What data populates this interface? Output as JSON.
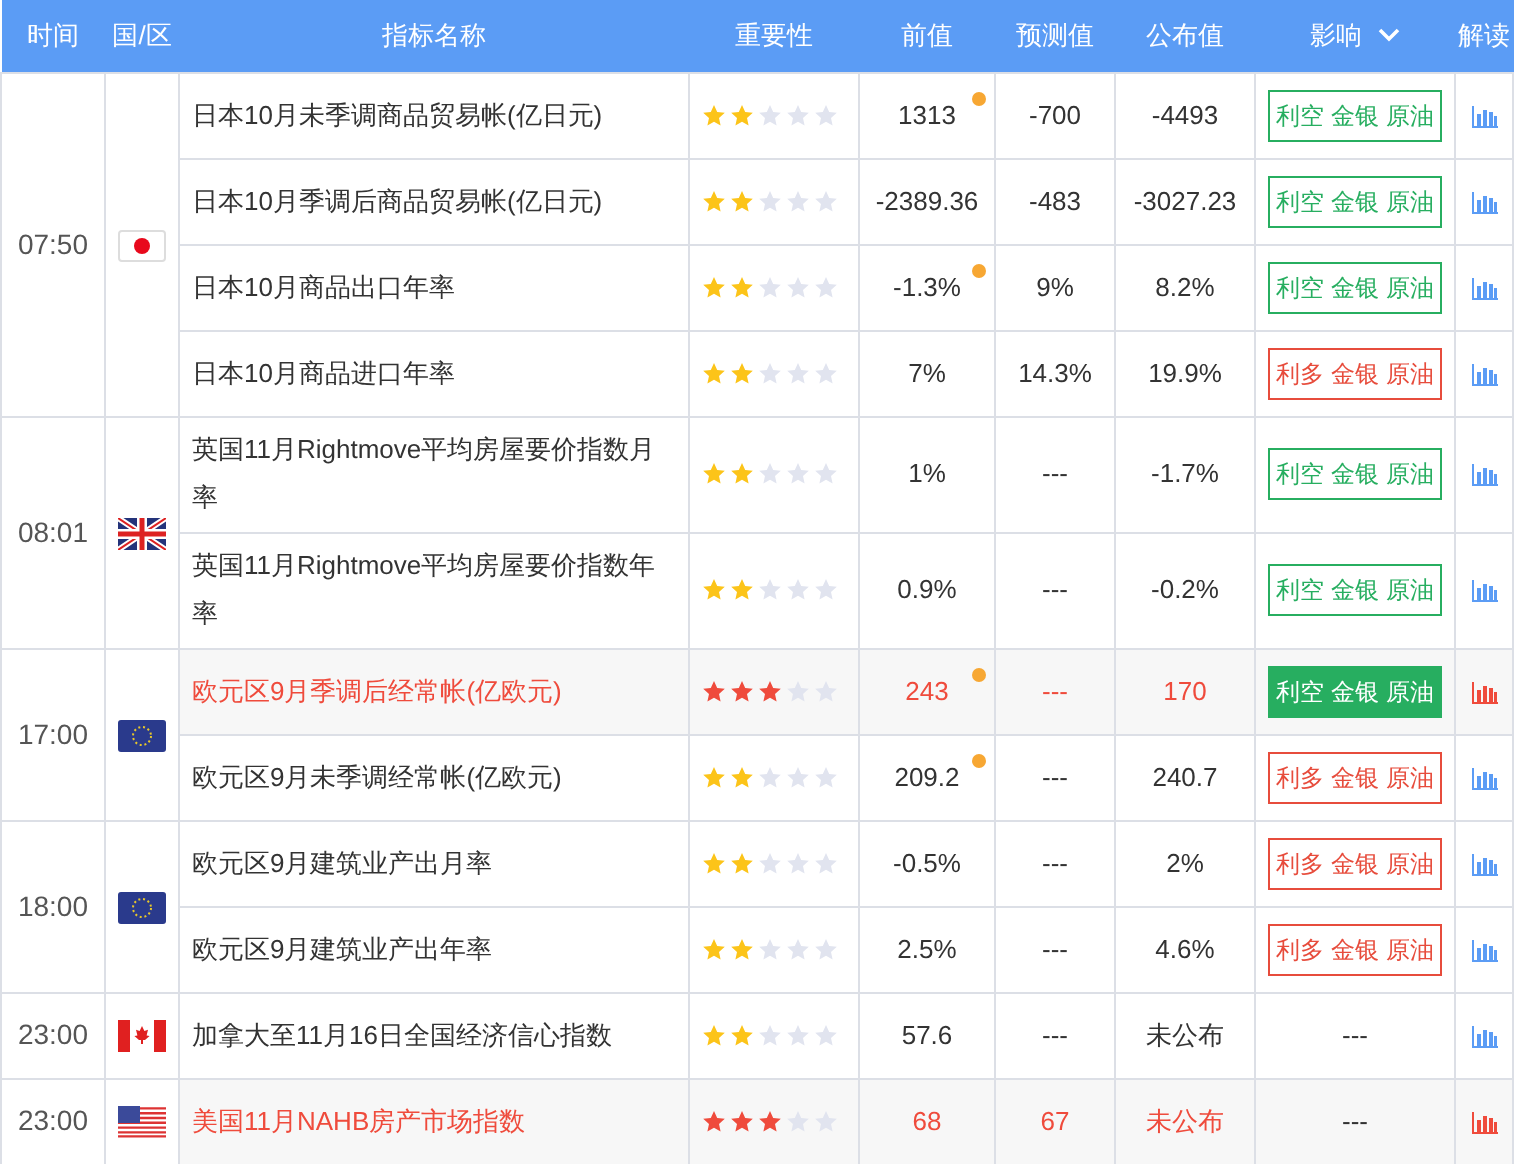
{
  "header": {
    "columns": [
      "时间",
      "国/区",
      "指标名称",
      "重要性",
      "前值",
      "预测值",
      "公布值",
      "影响",
      "解读"
    ]
  },
  "groups": [
    {
      "time": "07:50",
      "flag": {
        "kind": "jp"
      },
      "events": [
        {
          "name": "日本10月未季调商品贸易帐(亿日元)",
          "stars": 2,
          "highlighted": false,
          "previous": "1313",
          "revised": true,
          "forecast": "-700",
          "actual": "-4493",
          "impact": {
            "text": "利空 金银 原油",
            "kind": "bearish",
            "filled": false
          }
        },
        {
          "name": "日本10月季调后商品贸易帐(亿日元)",
          "stars": 2,
          "highlighted": false,
          "previous": "-2389.36",
          "forecast": "-483",
          "actual": "-3027.23",
          "impact": {
            "text": "利空 金银 原油",
            "kind": "bearish",
            "filled": false
          }
        },
        {
          "name": "日本10月商品出口年率",
          "stars": 2,
          "highlighted": false,
          "previous": "-1.3%",
          "revised": true,
          "forecast": "9%",
          "actual": "8.2%",
          "impact": {
            "text": "利空 金银 原油",
            "kind": "bearish",
            "filled": false
          }
        },
        {
          "name": "日本10月商品进口年率",
          "stars": 2,
          "highlighted": false,
          "previous": "7%",
          "forecast": "14.3%",
          "actual": "19.9%",
          "impact": {
            "text": "利多 金银 原油",
            "kind": "bullish",
            "filled": false
          }
        }
      ]
    },
    {
      "time": "08:01",
      "flag": {
        "kind": "gb"
      },
      "events": [
        {
          "name": "英国11月Rightmove平均房屋要价指数月率",
          "stars": 2,
          "highlighted": false,
          "previous": "1%",
          "forecast": "---",
          "actual": "-1.7%",
          "impact": {
            "text": "利空 金银 原油",
            "kind": "bearish",
            "filled": false
          }
        },
        {
          "name": "英国11月Rightmove平均房屋要价指数年率",
          "stars": 2,
          "highlighted": false,
          "previous": "0.9%",
          "forecast": "---",
          "actual": "-0.2%",
          "impact": {
            "text": "利空 金银 原油",
            "kind": "bearish",
            "filled": false
          }
        }
      ]
    },
    {
      "time": "17:00",
      "flag": {
        "kind": "eu"
      },
      "events": [
        {
          "name": "欧元区9月季调后经常帐(亿欧元)",
          "stars": 3,
          "highlighted": true,
          "previous": "243",
          "revised": true,
          "forecast": "---",
          "actual": "170",
          "impact": {
            "text": "利空 金银 原油",
            "kind": "bearish",
            "filled": true
          }
        },
        {
          "name": "欧元区9月未季调经常帐(亿欧元)",
          "stars": 2,
          "highlighted": false,
          "previous": "209.2",
          "revised": true,
          "forecast": "---",
          "actual": "240.7",
          "impact": {
            "text": "利多 金银 原油",
            "kind": "bullish",
            "filled": false
          }
        }
      ]
    },
    {
      "time": "18:00",
      "flag": {
        "kind": "eu"
      },
      "events": [
        {
          "name": "欧元区9月建筑业产出月率",
          "stars": 2,
          "highlighted": false,
          "previous": "-0.5%",
          "forecast": "---",
          "actual": "2%",
          "impact": {
            "text": "利多 金银 原油",
            "kind": "bullish",
            "filled": false
          }
        },
        {
          "name": "欧元区9月建筑业产出年率",
          "stars": 2,
          "highlighted": false,
          "previous": "2.5%",
          "forecast": "---",
          "actual": "4.6%",
          "impact": {
            "text": "利多 金银 原油",
            "kind": "bullish",
            "filled": false
          }
        }
      ]
    },
    {
      "time": "23:00",
      "flag": {
        "kind": "ca"
      },
      "events": [
        {
          "name": "加拿大至11月16日全国经济信心指数",
          "stars": 2,
          "highlighted": false,
          "previous": "57.6",
          "forecast": "---",
          "actual": "未公布",
          "impact": {
            "text": "---"
          }
        }
      ]
    },
    {
      "time": "23:00",
      "flag": {
        "kind": "us"
      },
      "events": [
        {
          "name": "美国11月NAHB房产市场指数",
          "stars": 3,
          "highlighted": true,
          "previous": "68",
          "forecast": "67",
          "actual": "未公布",
          "impact": {
            "text": "---"
          }
        }
      ]
    }
  ]
}
